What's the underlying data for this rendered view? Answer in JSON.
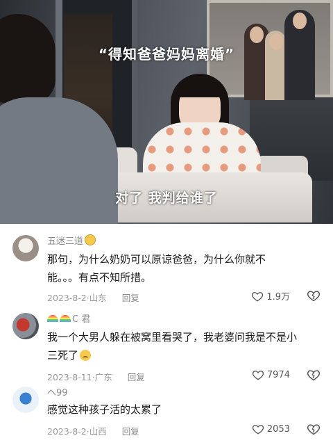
{
  "video": {
    "top_caption": "“得知爸爸妈妈离婚”",
    "subtitle": "对了 我判给谁了"
  },
  "comments": [
    {
      "username": "五迷三道",
      "username_badge_icon": "grinning-emoji-icon",
      "text_line1": "那句，为什么奶奶可以原谅爸爸，为什么你就不",
      "text_line2": "能。。。有点不知所措。",
      "date": "2023-8-2",
      "location": "山东",
      "reply_label": "回复",
      "likes": "1.9万"
    },
    {
      "username": "C 君",
      "username_prefix_icons": [
        "rainbow-icon",
        "rainbow-icon"
      ],
      "text_line1": "我一个大男人躲在被窝里看哭了，我老婆问我是不是小",
      "text_line2": "三死了",
      "text_suffix_icon": "crying-emoji-icon",
      "date": "2023-8-11",
      "location": "广东",
      "reply_label": "回复",
      "likes": "7974"
    },
    {
      "username": "ヘ99",
      "text_line1": "感觉这种孩子活的太累了",
      "date": "2023-8-2",
      "location": "山西",
      "reply_label": "回复",
      "likes": "2053"
    }
  ],
  "colors": {
    "text_primary": "#1a1a1a",
    "text_secondary": "#9a9a9a",
    "background": "#ffffff"
  }
}
